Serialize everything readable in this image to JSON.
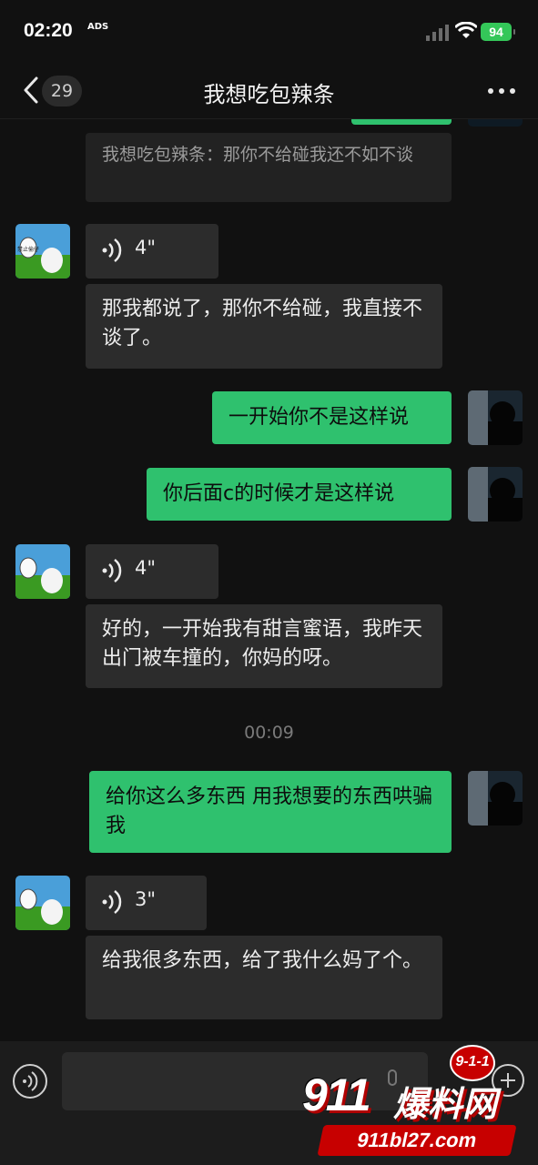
{
  "status_bar": {
    "time": "02:20",
    "time_sub": "ADS",
    "battery": "94"
  },
  "nav": {
    "unread_count": "29",
    "title": "我想吃包辣条"
  },
  "messages": {
    "quote_text": "我想吃包辣条：那你不给碰我还不如不谈",
    "voice1_duration": "4\"",
    "text1": "那我都说了，那你不给碰，我直接不谈了。",
    "text2": "一开始你不是这样说",
    "text3": "你后面c的时候才是这样说",
    "voice2_duration": "4\"",
    "text4": "好的，一开始我有甜言蜜语，我昨天出门被车撞的，你妈的呀。",
    "timestamp": "00:09",
    "text5": "给你这么多东西 用我想要的东西哄骗我",
    "voice3_duration": "3\"",
    "text6": "给我很多东西，给了我什么妈了个。"
  },
  "avatar": {
    "sign_text": "禁止偷仔"
  },
  "input": {
    "placeholder": ""
  },
  "watermark": {
    "badge": "9-1-1",
    "brand": "911",
    "brand_cn": "爆料网",
    "url": "911bl27.com"
  },
  "colors": {
    "sent_bubble": "#2fc16e",
    "received_bubble": "#2c2c2c",
    "background": "#111111",
    "battery": "#34c759",
    "watermark_red": "#c70000"
  },
  "icons": [
    "back-chevron-icon",
    "more-dots-icon",
    "voice-wave-icon",
    "voice-mode-icon",
    "plus-icon",
    "wifi-icon",
    "signal-icon"
  ]
}
